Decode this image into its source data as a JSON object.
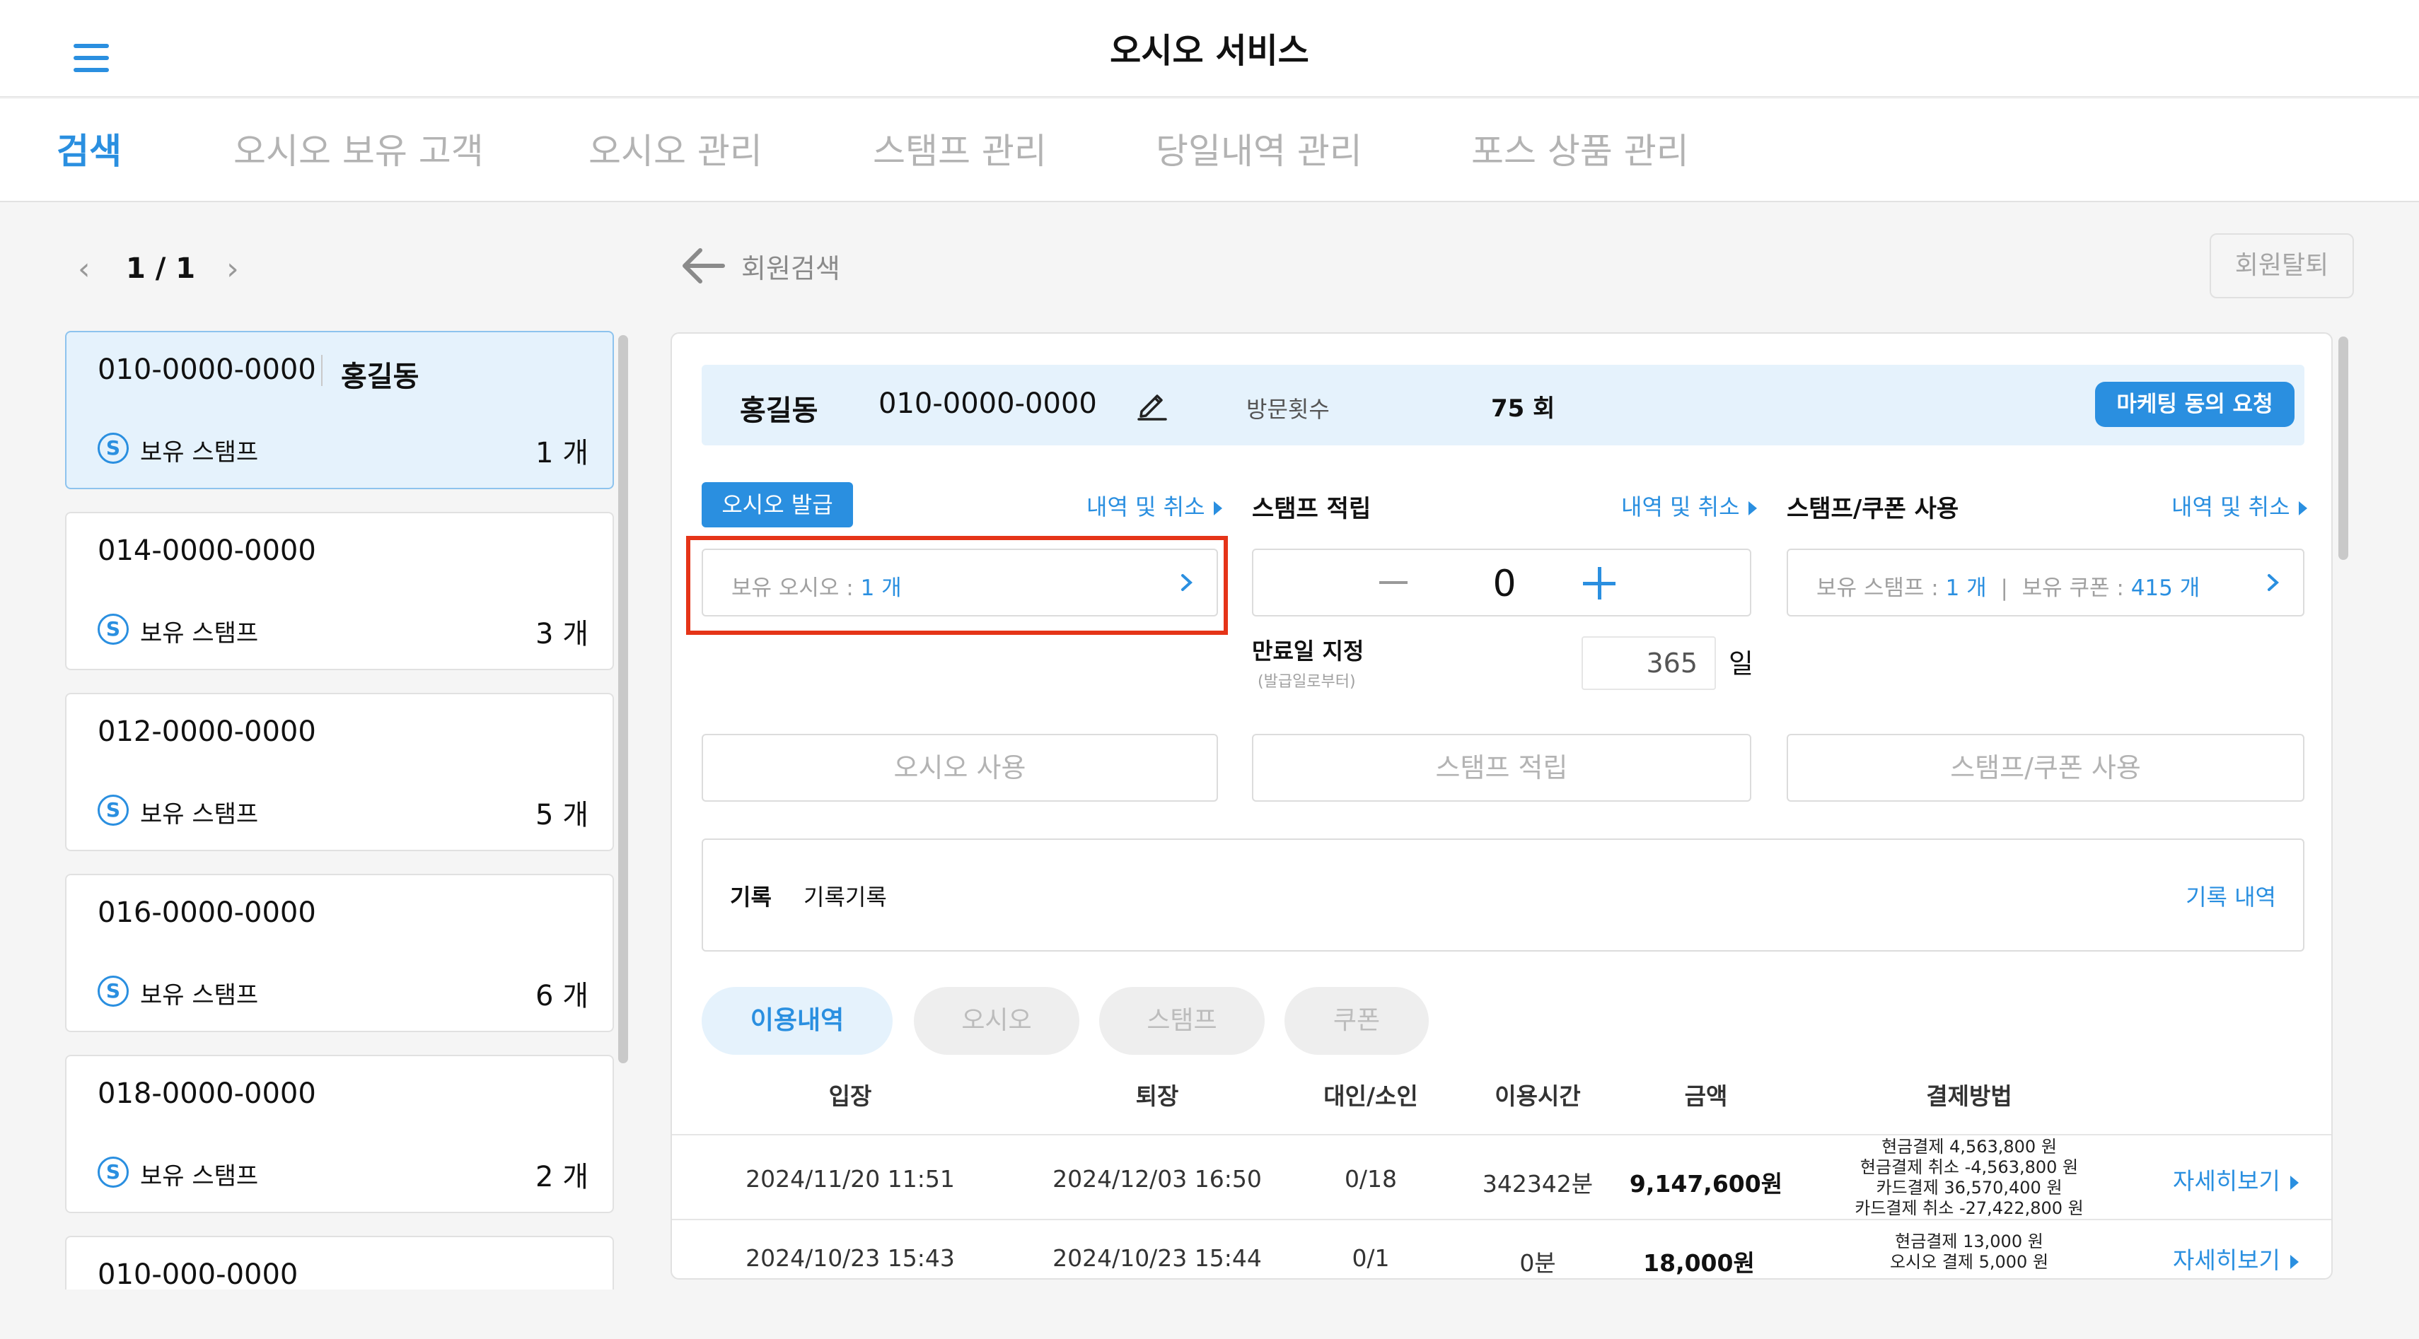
{
  "app": {
    "title": "오시오 서비스"
  },
  "tabs": [
    {
      "label": "검색"
    },
    {
      "label": "오시오 보유 고객"
    },
    {
      "label": "오시오 관리"
    },
    {
      "label": "스탬프 관리"
    },
    {
      "label": "당일내역 관리"
    },
    {
      "label": "포스 상품 관리"
    }
  ],
  "pager": {
    "text": "1 / 1"
  },
  "back": {
    "label": "회원검색"
  },
  "withdraw": {
    "label": "회원탈퇴"
  },
  "members": [
    {
      "phone": "010-0000-0000",
      "name": "홍길동",
      "stamp_label": "보유 스탬프",
      "stamp_count": "1 개"
    },
    {
      "phone": "014-0000-0000",
      "name": "",
      "stamp_label": "보유 스탬프",
      "stamp_count": "3 개"
    },
    {
      "phone": "012-0000-0000",
      "name": "",
      "stamp_label": "보유 스탬프",
      "stamp_count": "5 개"
    },
    {
      "phone": "016-0000-0000",
      "name": "",
      "stamp_label": "보유 스탬프",
      "stamp_count": "6 개"
    },
    {
      "phone": "018-0000-0000",
      "name": "",
      "stamp_label": "보유 스탬프",
      "stamp_count": "2 개"
    },
    {
      "phone": "010-000-0000",
      "name": "",
      "stamp_label": "",
      "stamp_count": ""
    }
  ],
  "member_bar": {
    "name": "홍길동",
    "phone": "010-0000-0000",
    "visit_label": "방문횟수",
    "visit_count": "75 회",
    "marketing_button": "마케팅 동의 요청"
  },
  "oshio": {
    "issue_button": "오시오 발급",
    "history_link": "내역 및 취소",
    "held_label": "보유 오시오 : ",
    "held_value": "1 개",
    "use_button": "오시오 사용"
  },
  "stamp_earn": {
    "title": "스탬프 적립",
    "history_link": "내역 및 취소",
    "value": "0",
    "expiry_label": "만료일 지정",
    "expiry_sub": "(발급일로부터)",
    "expiry_days": "365",
    "expiry_unit": "일",
    "earn_button": "스탬프 적립"
  },
  "stamp_use": {
    "title": "스탬프/쿠폰 사용",
    "history_link": "내역 및 취소",
    "stamp_label": "보유 스탬프 : ",
    "stamp_value": "1 개",
    "divider": "|",
    "coupon_label": "보유 쿠폰 : ",
    "coupon_value": "415 개",
    "use_button": "스탬프/쿠폰 사용"
  },
  "memo": {
    "label": "기록",
    "text": "기록기록",
    "link": "기록 내역"
  },
  "filters": [
    {
      "label": "이용내역"
    },
    {
      "label": "오시오"
    },
    {
      "label": "스탬프"
    },
    {
      "label": "쿠폰"
    }
  ],
  "table": {
    "headers": [
      "입장",
      "퇴장",
      "대인/소인",
      "이용시간",
      "금액",
      "결제방법"
    ],
    "rows": [
      {
        "entry": "2024/11/20 11:51",
        "exit": "2024/12/03 16:50",
        "people": "0/18",
        "duration": "342342분",
        "amount": "9,147,600원",
        "payments": [
          "현금결제 4,563,800 원",
          "현금결제 취소 -4,563,800 원",
          "카드결제 36,570,400 원",
          "카드결제 취소 -27,422,800 원"
        ],
        "detail": "자세히보기"
      },
      {
        "entry": "2024/10/23 15:43",
        "exit": "2024/10/23 15:44",
        "people": "0/1",
        "duration": "0분",
        "amount": "18,000원",
        "payments": [
          "현금결제 13,000 원",
          "오시오 결제 5,000 원"
        ],
        "detail": "자세히보기"
      }
    ]
  },
  "colors": {
    "accent": "#2a8fe0",
    "highlight": "#e53418",
    "selected_bg": "#e5f2fc"
  },
  "icons": [
    "menu-icon",
    "back-arrow-icon",
    "pencil-icon",
    "stamp-s-icon",
    "chevron-right-icon",
    "plus-icon",
    "minus-icon"
  ]
}
